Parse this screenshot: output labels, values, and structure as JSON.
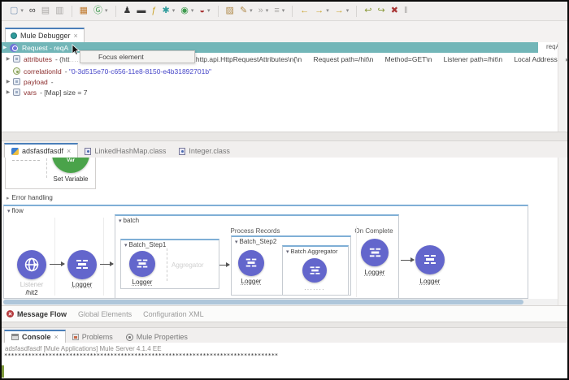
{
  "colors": {
    "selection_teal": "#72b6b8",
    "mule_purple": "#6366cc",
    "set_variable_green": "#4aa34a",
    "tab_accent_blue": "#4b7fb9",
    "error_red": "#b5393c"
  },
  "icons": {
    "chevron_right": "▶",
    "triangle_down": "▾",
    "triangle_right": "▸",
    "close": "×"
  },
  "toolbar": {
    "items": [
      {
        "name": "new-file",
        "g": "▢"
      },
      {
        "name": "new-dropdown",
        "g": "▾"
      },
      {
        "name": "mule-exchange",
        "g": "∞"
      },
      {
        "name": "save",
        "g": "▤"
      },
      {
        "name": "save-all",
        "g": "▥"
      },
      {
        "name": "package",
        "g": "▦"
      },
      {
        "name": "global-elements",
        "g": "Ⓖ"
      },
      {
        "name": "global-dropdown",
        "g": "▾"
      },
      {
        "name": "user",
        "g": "♟"
      },
      {
        "name": "terminal",
        "g": "▬"
      },
      {
        "name": "dataweave",
        "g": "ƒ"
      },
      {
        "name": "gear",
        "g": "✱"
      },
      {
        "name": "gear-dropdown",
        "g": "▾"
      },
      {
        "name": "run",
        "g": "◉"
      },
      {
        "name": "run-dropdown",
        "g": "▾"
      },
      {
        "name": "debug",
        "g": "◒"
      },
      {
        "name": "debug-dropdown",
        "g": "▾"
      },
      {
        "name": "open-resource",
        "g": "▨"
      },
      {
        "name": "external-tools",
        "g": "✎"
      },
      {
        "name": "tools-dropdown",
        "g": "▾"
      },
      {
        "name": "skip-breakpoints",
        "g": "»"
      },
      {
        "name": "skip-dropdown",
        "g": "▾"
      },
      {
        "name": "mark-occurrences",
        "g": "≡"
      },
      {
        "name": "mark-dropdown",
        "g": "▾"
      },
      {
        "name": "back",
        "g": "←"
      },
      {
        "name": "forward",
        "g": "→"
      },
      {
        "name": "forward-dropdown",
        "g": "▾"
      },
      {
        "name": "last-edit",
        "g": "→"
      },
      {
        "name": "last-edit-dropdown",
        "g": "▾"
      },
      {
        "name": "step-return",
        "g": "↩"
      },
      {
        "name": "step-into",
        "g": "↪"
      },
      {
        "name": "terminate",
        "g": "✖"
      },
      {
        "name": "suspend",
        "g": "‖"
      }
    ]
  },
  "debugger": {
    "tab_label": "Mule Debugger",
    "tooltip": "Focus element",
    "request_row": {
      "label": "Request - reqA",
      "overflow_value": "reqAt"
    },
    "rows": [
      {
        "name": "attributes",
        "v1": "- (htt",
        "dots": "………………………",
        "v2": ", org.mule.extension.http.api.HttpRequestAttributes\\n{\\n      Request path=/hit\\n      Method=GET\\n      Listener path=/hit\\n      Local Address=localhost/"
      },
      {
        "name": "correlationId",
        "sep": "- ",
        "value": "\"0-3d515e70-c656-11e8-8150-e4b31892701b\""
      },
      {
        "name": "payload",
        "sep": "-",
        "value": ""
      },
      {
        "name": "vars",
        "sep": "- ",
        "value": "[Map] size = 7"
      }
    ]
  },
  "editor": {
    "tabs": [
      {
        "label": "adsfasdfasdf"
      },
      {
        "label": "LinkedHashMap.class"
      },
      {
        "label": "Integer.class"
      }
    ],
    "snippet": {
      "var_badge": "Var",
      "set_variable": "Set Variable",
      "error_handling": "Error handling"
    },
    "flow": {
      "title": "flow",
      "listener_label": "Listener",
      "listener_path": "/hit2",
      "logger1": "Logger",
      "batch": {
        "title": "batch",
        "process_records": "Process Records",
        "on_complete": "On Complete",
        "step1": {
          "title": "Batch_Step1",
          "logger": "Logger",
          "placeholder": "Aggregator"
        },
        "step2": {
          "title": "Batch_Step2",
          "logger": "Logger",
          "aggregator": {
            "title": "Batch Aggregator",
            "logger_clipped": "·······"
          }
        },
        "on_complete_logger": "Logger"
      },
      "logger2": "Logger"
    },
    "bottom_tabs": [
      {
        "label": "Message Flow"
      },
      {
        "label": "Global Elements"
      },
      {
        "label": "Configuration XML"
      }
    ]
  },
  "console": {
    "tabs": [
      {
        "label": "Console"
      },
      {
        "label": "Problems"
      },
      {
        "label": "Mule Properties"
      }
    ],
    "line1": "adsfasdfasdf [Mule Applications] Mule Server 4.1.4 EE",
    "asterisks": "********************************************************************************"
  }
}
